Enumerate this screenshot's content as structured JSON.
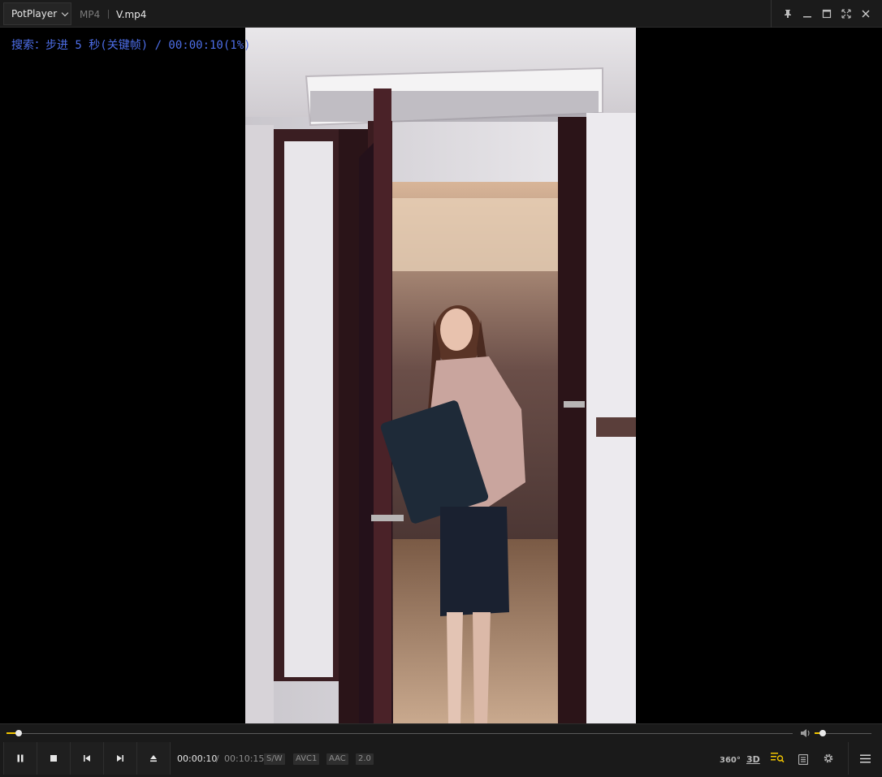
{
  "window": {
    "app_name": "PotPlayer",
    "format": "MP4",
    "file_name": "V.mp4",
    "controls": [
      "pin-icon",
      "minimize-icon",
      "maximize-icon",
      "fullscreen-icon",
      "close-icon"
    ]
  },
  "osd": {
    "message": "搜索：步进 5 秒(关键帧) / 00:00:10(1%)",
    "color": "#4d6ee8"
  },
  "playback": {
    "current_time": "00:00:10",
    "separator": "/",
    "total_time": "00:10:15",
    "progress_fraction": 0.016,
    "volume_fraction": 0.14
  },
  "tags": [
    "S/W",
    "AVC1",
    "AAC",
    "2.0"
  ],
  "right_buttons": {
    "vr": "360°",
    "three_d": "3D"
  },
  "colors": {
    "accent": "#f2c500",
    "titlebar_bg": "#1b1b1b",
    "controlbar_bg": "#1a1a1a"
  }
}
